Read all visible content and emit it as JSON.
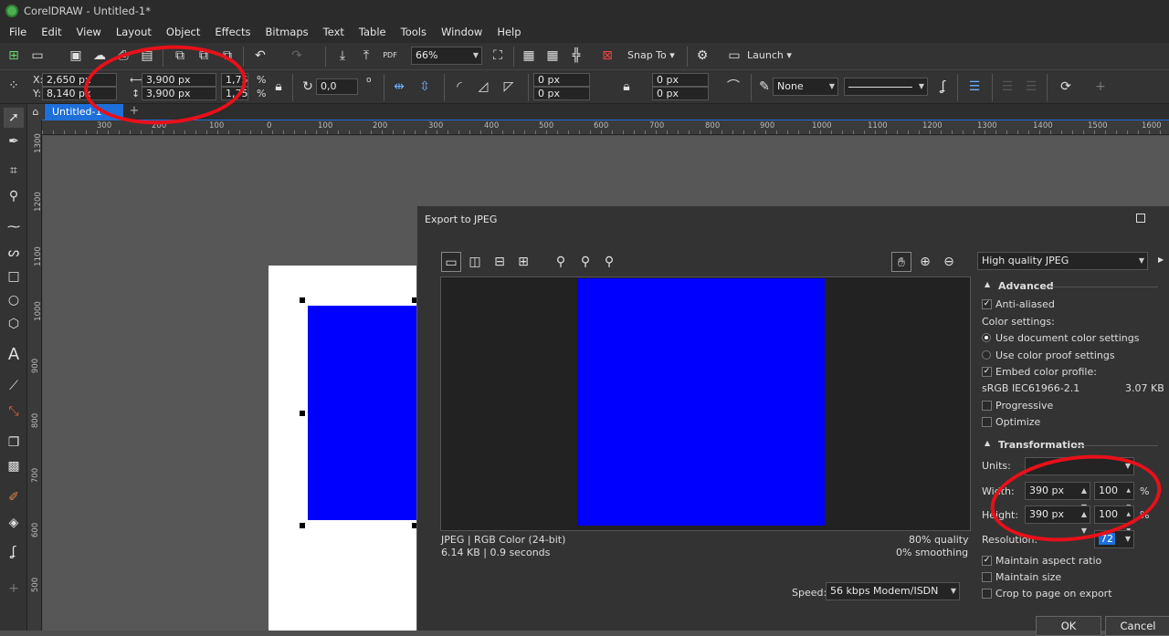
{
  "app": {
    "title": "CorelDRAW - Untitled-1*"
  },
  "menu": [
    "File",
    "Edit",
    "View",
    "Layout",
    "Object",
    "Effects",
    "Bitmaps",
    "Text",
    "Table",
    "Tools",
    "Window",
    "Help"
  ],
  "toolbar": {
    "zoom": "66%",
    "snap_to": "Snap To",
    "launch": "Launch"
  },
  "propbar": {
    "x_label": "X:",
    "x": "2,650 px",
    "y_label": "Y:",
    "y": "8,140 px",
    "width": "3,900 px",
    "height": "3,900 px",
    "scale_w": "1,75",
    "scale_h": "1,75",
    "pct": "%",
    "rotation": "0,0",
    "degree": "o",
    "corner1": "0 px",
    "corner2": "0 px",
    "corner3": "0 px",
    "corner4": "0 px",
    "outline": "None"
  },
  "doc_tab": "Untitled-1",
  "ruler_top": [
    "300",
    "200",
    "100",
    "0",
    "100",
    "200",
    "300",
    "400",
    "500",
    "600",
    "700",
    "800",
    "900",
    "1000",
    "1100",
    "1200",
    "1300",
    "1400",
    "1500",
    "1600"
  ],
  "ruler_left": [
    "1300",
    "1200",
    "1100",
    "1000",
    "900",
    "800",
    "700",
    "600",
    "500"
  ],
  "dialog": {
    "title": "Export to JPEG",
    "preset": "High quality JPEG",
    "advanced_header": "Advanced",
    "anti_aliased": "Anti-aliased",
    "color_settings": "Color settings:",
    "use_doc_color": "Use document color settings",
    "use_proof": "Use color proof settings",
    "embed_profile": "Embed color profile:",
    "profile_name": "sRGB IEC61966-2.1",
    "profile_size": "3.07 KB",
    "progressive": "Progressive",
    "optimize": "Optimize",
    "transformation_header": "Transformation",
    "units_label": "Units:",
    "width_label": "Width:",
    "height_label": "Height:",
    "width_px": "390 px",
    "height_px": "390 px",
    "width_pct": "100",
    "height_pct": "100",
    "pct": "%",
    "resolution_label": "Resolution:",
    "resolution": "72",
    "maintain_aspect": "Maintain aspect ratio",
    "maintain_size": "Maintain size",
    "crop_to_page": "Crop to page on export",
    "info_format": "JPEG  |  RGB Color (24-bit)",
    "info_size": "6.14 KB  |  0.9 seconds",
    "quality": "80% quality",
    "smoothing": "0% smoothing",
    "speed_label": "Speed:",
    "speed": "56 kbps Modem/ISDN",
    "ok": "OK",
    "cancel": "Cancel"
  },
  "colors": {
    "accent": "#0000ff",
    "annotation": "#e8101a",
    "tab_active": "#1e6fd9"
  }
}
